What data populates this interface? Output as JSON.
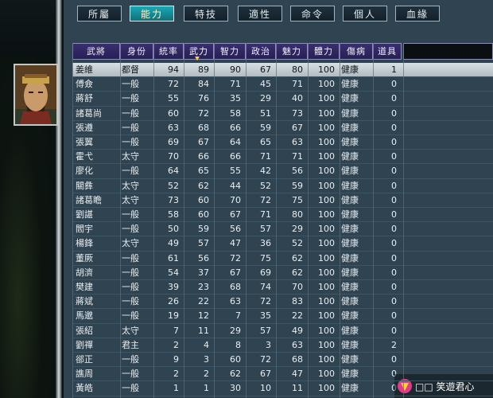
{
  "tabs": [
    "所屬",
    "能力",
    "特技",
    "適性",
    "命令",
    "個人",
    "血緣"
  ],
  "active_tab": 1,
  "columns": [
    "武將",
    "身份",
    "統率",
    "武力",
    "智力",
    "政治",
    "魅力",
    "體力",
    "傷病",
    "道具"
  ],
  "sorted_column": 3,
  "selected_row": 0,
  "rows": [
    [
      "姜維",
      "都督",
      "94",
      "89",
      "90",
      "67",
      "80",
      "100",
      "健康",
      "1"
    ],
    [
      "傅僉",
      "一般",
      "72",
      "84",
      "71",
      "45",
      "71",
      "100",
      "健康",
      "0"
    ],
    [
      "蔣舒",
      "一般",
      "55",
      "76",
      "35",
      "29",
      "40",
      "100",
      "健康",
      "0"
    ],
    [
      "諸葛尚",
      "一般",
      "60",
      "72",
      "58",
      "51",
      "73",
      "100",
      "健康",
      "0"
    ],
    [
      "張遵",
      "一般",
      "63",
      "68",
      "66",
      "59",
      "67",
      "100",
      "健康",
      "0"
    ],
    [
      "張翼",
      "一般",
      "69",
      "67",
      "64",
      "65",
      "63",
      "100",
      "健康",
      "0"
    ],
    [
      "霍弋",
      "太守",
      "70",
      "66",
      "66",
      "71",
      "71",
      "100",
      "健康",
      "0"
    ],
    [
      "廖化",
      "一般",
      "64",
      "65",
      "55",
      "42",
      "56",
      "100",
      "健康",
      "0"
    ],
    [
      "關彝",
      "太守",
      "52",
      "62",
      "44",
      "52",
      "59",
      "100",
      "健康",
      "0"
    ],
    [
      "諸葛瞻",
      "太守",
      "73",
      "60",
      "70",
      "72",
      "75",
      "100",
      "健康",
      "0"
    ],
    [
      "劉諶",
      "一般",
      "58",
      "60",
      "67",
      "71",
      "80",
      "100",
      "健康",
      "0"
    ],
    [
      "閻宇",
      "一般",
      "50",
      "59",
      "56",
      "57",
      "29",
      "100",
      "健康",
      "0"
    ],
    [
      "楊鋒",
      "太守",
      "49",
      "57",
      "47",
      "36",
      "52",
      "100",
      "健康",
      "0"
    ],
    [
      "董厥",
      "一般",
      "61",
      "56",
      "72",
      "75",
      "62",
      "100",
      "健康",
      "0"
    ],
    [
      "胡濟",
      "一般",
      "54",
      "37",
      "67",
      "69",
      "62",
      "100",
      "健康",
      "0"
    ],
    [
      "樊建",
      "一般",
      "39",
      "23",
      "68",
      "74",
      "70",
      "100",
      "健康",
      "0"
    ],
    [
      "蔣斌",
      "一般",
      "26",
      "22",
      "63",
      "72",
      "83",
      "100",
      "健康",
      "0"
    ],
    [
      "馬邈",
      "一般",
      "19",
      "12",
      "7",
      "35",
      "22",
      "100",
      "健康",
      "0"
    ],
    [
      "張紹",
      "太守",
      "7",
      "11",
      "29",
      "57",
      "49",
      "100",
      "健康",
      "0"
    ],
    [
      "劉禪",
      "君主",
      "2",
      "4",
      "8",
      "3",
      "63",
      "100",
      "健康",
      "2"
    ],
    [
      "郤正",
      "一般",
      "9",
      "3",
      "60",
      "72",
      "68",
      "100",
      "健康",
      "0"
    ],
    [
      "譙周",
      "一般",
      "2",
      "2",
      "62",
      "67",
      "47",
      "100",
      "健康",
      "0"
    ],
    [
      "黃皓",
      "一般",
      "1",
      "1",
      "30",
      "10",
      "11",
      "100",
      "健康",
      "0"
    ]
  ],
  "watermark_text": "□□ 笑遊君心"
}
